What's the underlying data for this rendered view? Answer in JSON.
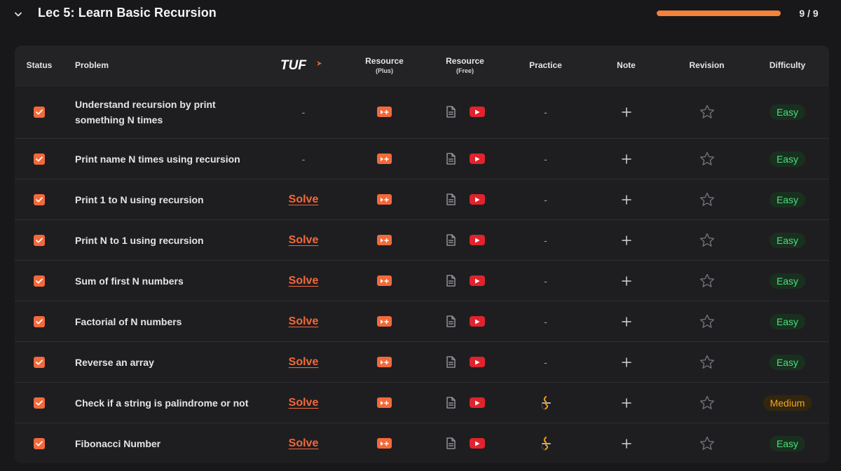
{
  "section": {
    "title": "Lec 5: Learn Basic Recursion",
    "progress_text": "9 / 9",
    "progress_fraction": 1.0
  },
  "table": {
    "headers": {
      "status": "Status",
      "problem": "Problem",
      "tuf_logo": "TUF",
      "resource_plus": "Resource",
      "resource_plus_sub": "(Plus)",
      "resource_free": "Resource",
      "resource_free_sub": "(Free)",
      "practice": "Practice",
      "note": "Note",
      "revision": "Revision",
      "difficulty": "Difficulty"
    },
    "rows": [
      {
        "checked": true,
        "problem": "Understand recursion by print something N times",
        "tuf": "-",
        "practice": "-",
        "difficulty": "Easy",
        "level": "easy"
      },
      {
        "checked": true,
        "problem": "Print name N times using recursion",
        "tuf": "-",
        "practice": "-",
        "difficulty": "Easy",
        "level": "easy"
      },
      {
        "checked": true,
        "problem": "Print 1 to N using recursion",
        "tuf": "Solve",
        "practice": "-",
        "difficulty": "Easy",
        "level": "easy"
      },
      {
        "checked": true,
        "problem": "Print N to 1 using recursion",
        "tuf": "Solve",
        "practice": "-",
        "difficulty": "Easy",
        "level": "easy"
      },
      {
        "checked": true,
        "problem": "Sum of first N numbers",
        "tuf": "Solve",
        "practice": "-",
        "difficulty": "Easy",
        "level": "easy"
      },
      {
        "checked": true,
        "problem": "Factorial of N numbers",
        "tuf": "Solve",
        "practice": "-",
        "difficulty": "Easy",
        "level": "easy"
      },
      {
        "checked": true,
        "problem": "Reverse an array",
        "tuf": "Solve",
        "practice": "-",
        "difficulty": "Easy",
        "level": "easy"
      },
      {
        "checked": true,
        "problem": "Check if a string is palindrome or not",
        "tuf": "Solve",
        "practice": "logo",
        "difficulty": "Medium",
        "level": "medium"
      },
      {
        "checked": true,
        "problem": "Fibonacci Number",
        "tuf": "Solve",
        "practice": "logo",
        "difficulty": "Easy",
        "level": "easy"
      }
    ]
  },
  "icons": {
    "collapse": "chevron-down-icon",
    "status": "checkbox-checked-icon",
    "resource_plus": "play-plus-icon",
    "article": "document-icon",
    "video": "youtube-icon",
    "practice": "practice-platform-logo",
    "note": "plus-icon",
    "revision": "star-outline-icon"
  },
  "colors": {
    "accent": "#f4693a",
    "progress": "#f4823a",
    "youtube": "#e0232d",
    "easy": "#4ade80",
    "medium": "#f5a524",
    "background": "#18181b",
    "table_bg": "#1e1e21"
  }
}
